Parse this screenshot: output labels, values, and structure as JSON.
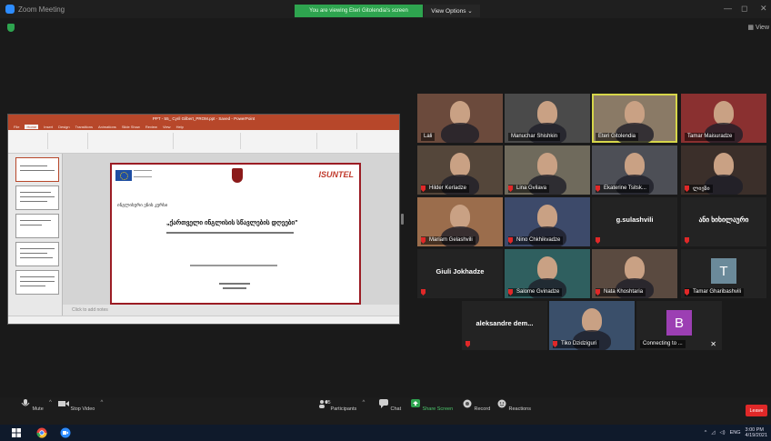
{
  "window": {
    "title": "Zoom Meeting",
    "banner": "You are viewing Eteri Gitolendia's screen",
    "view_options": "View Options ⌄",
    "minimize": "—",
    "maximize": "◻",
    "close": "✕",
    "view_toggle": "▦ View"
  },
  "shared_screen": {
    "ppt_title": "PPT - 55_ Cyril Gilbert_PROM.ppt - Saved - PowerPoint",
    "ribbon_tabs": [
      "File",
      "Home",
      "Insert",
      "Design",
      "Transitions",
      "Animations",
      "Slide Show",
      "Review",
      "View",
      "Help"
    ],
    "slide_logo": "ISUNTEL",
    "slide_heading": "ინგლისური ენის კურსი",
    "slide_title": "„ქართველი ინგლისის სწავლების დღეები\"",
    "notes_placeholder": "Click to add notes"
  },
  "gallery": [
    {
      "name": "Lali",
      "type": "video",
      "bg": "#6b4a3c",
      "muted": false
    },
    {
      "name": "Manuchar Shishkin",
      "type": "video",
      "bg": "#4a4a4a",
      "muted": false
    },
    {
      "name": "Eteri Gitolendia",
      "type": "video",
      "bg": "#8a7a66",
      "muted": false,
      "speaker": true
    },
    {
      "name": "Tamar Maisuradze",
      "type": "video",
      "bg": "#8a3030",
      "muted": false
    },
    {
      "name": "Hilder Kerladze",
      "type": "video",
      "bg": "#54463a",
      "muted": true
    },
    {
      "name": "Lina Gvilava",
      "type": "video",
      "bg": "#6f6a5c",
      "muted": true
    },
    {
      "name": "Ekaterine Tsitsk...",
      "type": "video",
      "bg": "#4d4f56",
      "muted": true
    },
    {
      "name": "ლიეზი",
      "type": "video",
      "bg": "#3b2f2a",
      "muted": true
    },
    {
      "name": "Mariam Gelashvili",
      "type": "video",
      "bg": "#9b6d4c",
      "muted": true
    },
    {
      "name": "Nino Chkhikvadze",
      "type": "video",
      "bg": "#3d4a6a",
      "muted": true
    },
    {
      "name": "g.sulashvili",
      "type": "name",
      "muted": true
    },
    {
      "name": "ანი ხიხილაური",
      "type": "name",
      "muted": true
    },
    {
      "name": "Giuli Jokhadze",
      "type": "name",
      "muted": true
    },
    {
      "name": "Salome Gvinadze",
      "type": "video",
      "bg": "#2f5f5f",
      "muted": true
    },
    {
      "name": "Nata Khoshtaria",
      "type": "video",
      "bg": "#5a4a40",
      "muted": true
    },
    {
      "name": "Tamar Gharibashvili",
      "type": "avatar",
      "letter": "T",
      "avatar_bg": "#6b8a9a",
      "muted": true
    },
    {
      "name": "aleksandre dem...",
      "type": "name",
      "muted": true
    },
    {
      "name": "Tiko Dzidziguri",
      "type": "video",
      "bg": "#3a4f6a",
      "muted": true
    },
    {
      "name": "Connecting to ...",
      "type": "avatar",
      "letter": "B",
      "avatar_bg": "#9c3fb3",
      "muted": false,
      "closable": true
    }
  ],
  "toolbar": {
    "mute": "Mute",
    "stop_video": "Stop Video",
    "participants": "Participants",
    "participants_count": "25",
    "chat": "Chat",
    "share_screen": "Share Screen",
    "record": "Record",
    "reactions": "Reactions",
    "leave": "Leave"
  },
  "taskbar": {
    "lang": "ENG",
    "time": "3:00 PM",
    "date": "4/19/2021"
  },
  "colors": {
    "share_green": "#2ea44f",
    "leave_red": "#e02828",
    "ppt_red": "#b7472a",
    "speaker_yellow": "#d6d64a"
  }
}
